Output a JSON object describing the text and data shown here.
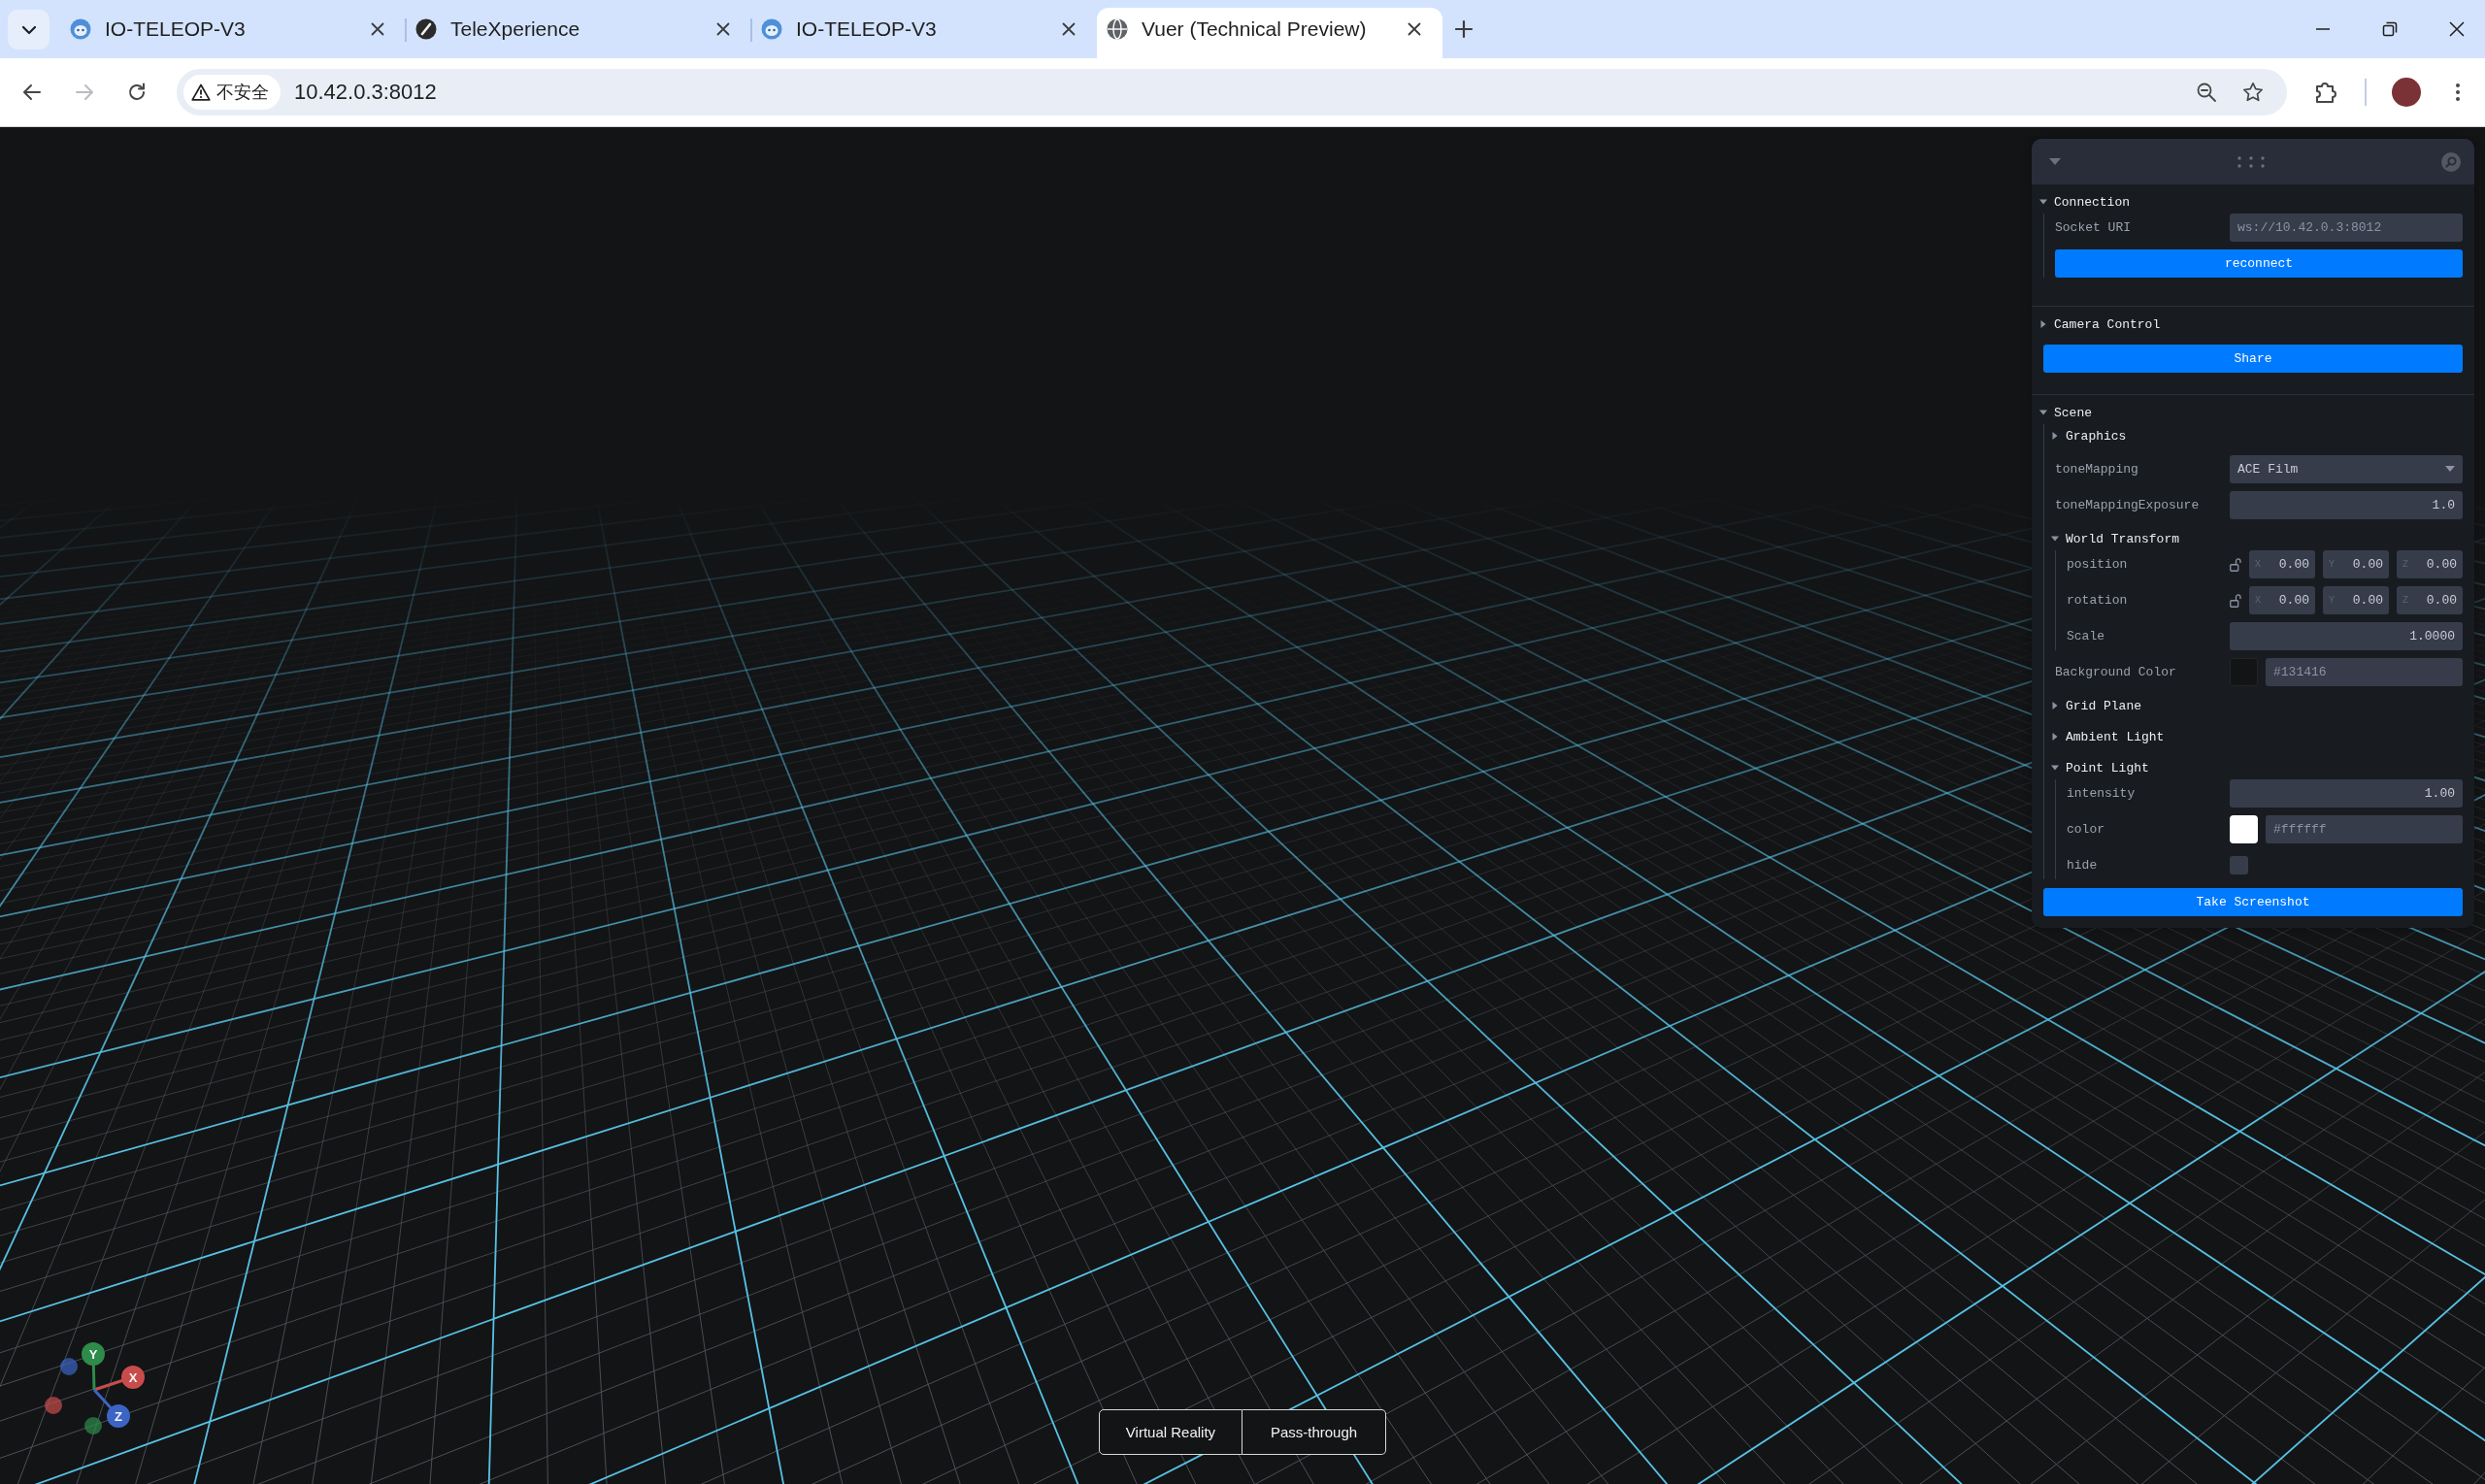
{
  "browser": {
    "tabs": [
      {
        "title": "IO-TELEOP-V3",
        "selected": false
      },
      {
        "title": "TeleXperience",
        "selected": false
      },
      {
        "title": "IO-TELEOP-V3",
        "selected": false
      },
      {
        "title": "Vuer (Technical Preview)",
        "selected": true
      }
    ],
    "nav_buttons": [
      {
        "kind": "back",
        "disabled": false
      },
      {
        "kind": "forward",
        "disabled": true
      },
      {
        "kind": "reload",
        "disabled": false
      }
    ],
    "address_bar": {
      "security_label": "不安全",
      "url": "10.42.0.3:8012"
    }
  },
  "panel": {
    "items": [
      {
        "kind": "folder",
        "title": "Connection",
        "expanded": true,
        "children": [
          {
            "kind": "text",
            "label": "Socket URI",
            "value": "ws://10.42.0.3:8012"
          },
          {
            "kind": "button",
            "label": "reconnect"
          }
        ]
      },
      {
        "kind": "folder",
        "title": "Camera Control",
        "expanded": false
      },
      {
        "kind": "button",
        "label": "Share"
      },
      {
        "kind": "folder",
        "title": "Scene",
        "expanded": true,
        "children": [
          {
            "kind": "folder",
            "title": "Graphics",
            "expanded": false
          },
          {
            "kind": "select",
            "label": "toneMapping",
            "value": "ACE Film"
          },
          {
            "kind": "number",
            "label": "toneMappingExposure",
            "value": "1.0"
          },
          {
            "kind": "folder",
            "title": "World Transform",
            "expanded": true,
            "children": [
              {
                "kind": "vector",
                "label": "position",
                "locked": false,
                "components": [
                  {
                    "axis": "X",
                    "value": "0.00"
                  },
                  {
                    "axis": "Y",
                    "value": "0.00"
                  },
                  {
                    "axis": "Z",
                    "value": "0.00"
                  }
                ]
              },
              {
                "kind": "vector",
                "label": "rotation",
                "locked": false,
                "components": [
                  {
                    "axis": "X",
                    "value": "0.00"
                  },
                  {
                    "axis": "Y",
                    "value": "0.00"
                  },
                  {
                    "axis": "Z",
                    "value": "0.00"
                  }
                ]
              },
              {
                "kind": "number",
                "label": "Scale",
                "value": "1.0000"
              }
            ]
          },
          {
            "kind": "color",
            "label": "Background Color",
            "value": "#131416",
            "color": "#131416"
          },
          {
            "kind": "folder",
            "title": "Grid Plane",
            "expanded": false
          },
          {
            "kind": "folder",
            "title": "Ambient Light",
            "expanded": false
          },
          {
            "kind": "folder",
            "title": "Point Light",
            "expanded": true,
            "children": [
              {
                "kind": "number",
                "label": "intensity",
                "value": "1.00"
              },
              {
                "kind": "color",
                "label": "color",
                "value": "#ffffff",
                "color": "#ffffff"
              },
              {
                "kind": "checkbox",
                "label": "hide",
                "checked": false
              }
            ]
          }
        ]
      },
      {
        "kind": "button",
        "label": "Take Screenshot"
      }
    ]
  },
  "viewport": {
    "axis_gizmo": [
      {
        "label": "X",
        "color": "#c94c4c"
      },
      {
        "label": "Y",
        "color": "#2e8b4a"
      },
      {
        "label": "Z",
        "color": "#3b64c4"
      }
    ],
    "mode_buttons": [
      {
        "label": "Virtual Reality"
      },
      {
        "label": "Pass-through"
      }
    ]
  }
}
